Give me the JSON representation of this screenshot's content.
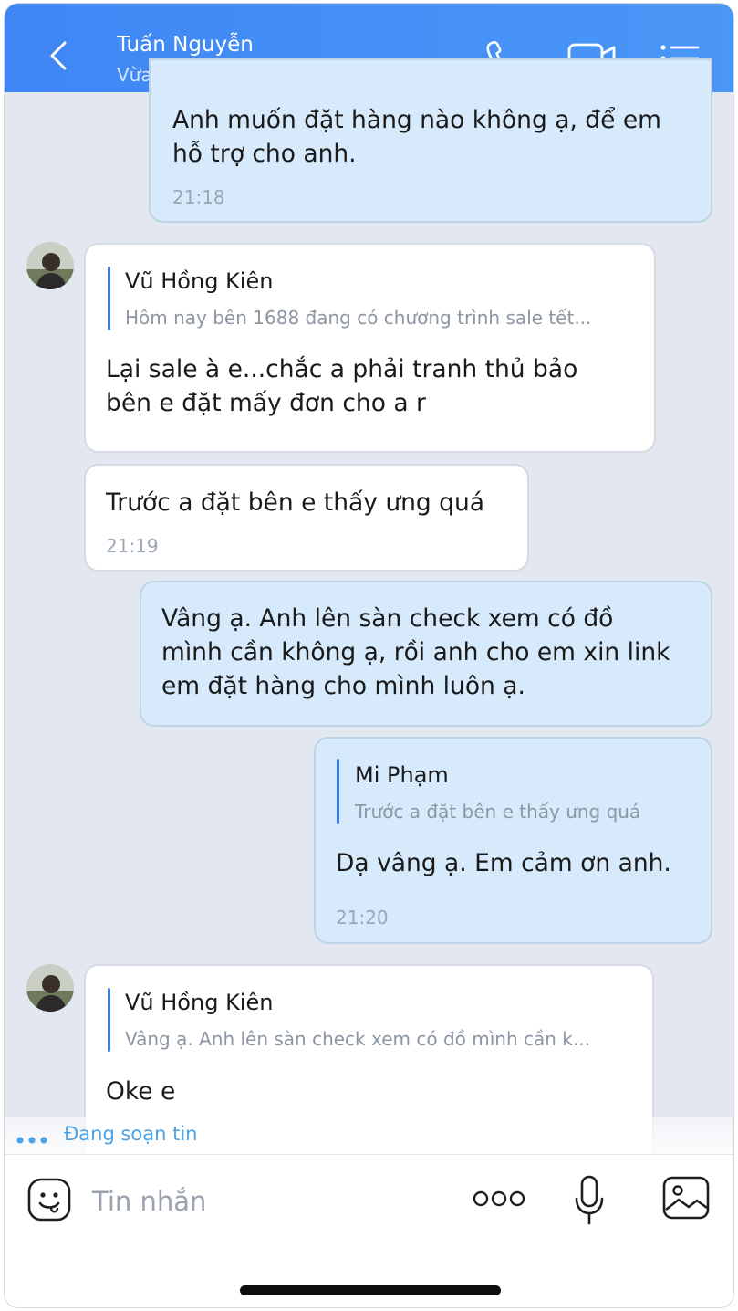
{
  "header": {
    "contact_name": "Tuấn Nguyễn",
    "status": "Vừa mới truy cập",
    "back_icon": "chevron-left-icon",
    "call_icon": "phone-icon",
    "video_icon": "video-camera-icon",
    "menu_icon": "list-menu-icon",
    "color": "#3f86f5"
  },
  "messages": [
    {
      "direction": "out",
      "lines": [
        "Anh muốn đặt hàng nào không ạ, để em",
        "hỗ trợ cho anh."
      ],
      "time": "21:18"
    },
    {
      "direction": "in",
      "quote": {
        "name": "Vũ Hồng Kiên",
        "text": "Hôm nay bên 1688 đang có chương trình sale tết..."
      },
      "lines": [
        "Lại sale à e...chắc a phải tranh thủ bảo",
        "bên e đặt mấy đơn cho a r"
      ]
    },
    {
      "direction": "in",
      "lines": [
        "Trước a đặt bên e thấy ưng quá"
      ],
      "time": "21:19"
    },
    {
      "direction": "out",
      "lines": [
        "Vâng ạ. Anh lên sàn check xem có đồ",
        "mình cần không ạ, rồi anh cho em xin link",
        "em đặt hàng cho mình luôn ạ."
      ]
    },
    {
      "direction": "out",
      "quote": {
        "name": "Mi Phạm",
        "text": "Trước a đặt bên e thấy ưng quá"
      },
      "lines": [
        "Dạ vâng ạ. Em cảm ơn anh."
      ],
      "time": "21:20"
    },
    {
      "direction": "in",
      "quote": {
        "name": "Vũ Hồng Kiên",
        "text": "Vâng ạ. Anh lên sàn check xem có đồ mình cần k..."
      },
      "lines": [
        "Oke e"
      ]
    }
  ],
  "typing": {
    "text": "Đang soạn tin"
  },
  "composer": {
    "placeholder": "Tin nhắn",
    "sticker_icon": "sticker-smile-icon",
    "more_icon": "more-dots-icon",
    "mic_icon": "microphone-icon",
    "image_icon": "image-icon"
  },
  "colors": {
    "chat_bg": "#e3e7ef",
    "outgoing_bubble": "#d6eafb",
    "incoming_bubble": "#ffffff",
    "quote_bar": "#3a7ee8",
    "typing_text": "#4aa3e8"
  }
}
